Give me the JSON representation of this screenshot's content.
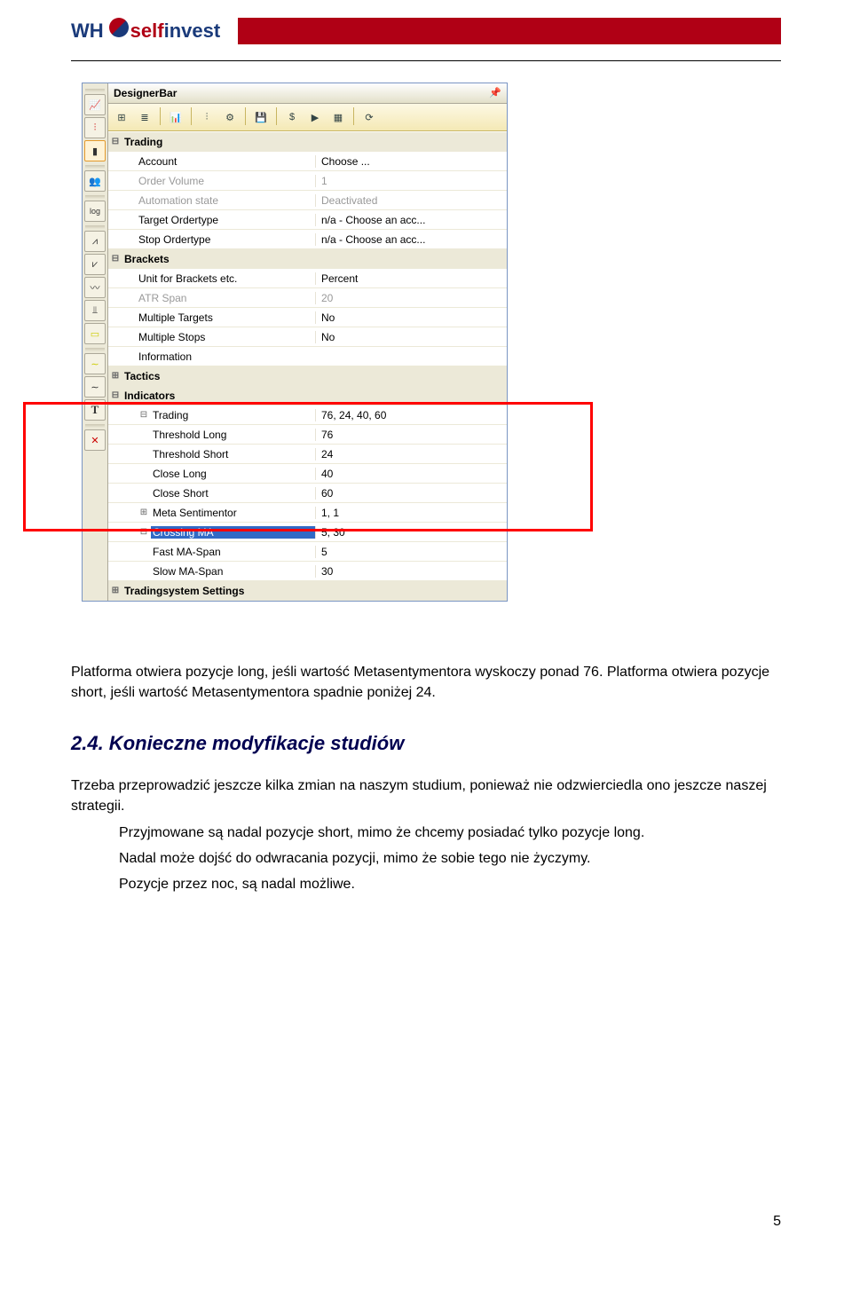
{
  "header": {
    "logo_wh": "WH",
    "logo_self": "self",
    "logo_invest": "invest"
  },
  "designer": {
    "title": "DesignerBar",
    "sections": {
      "trading": {
        "label": "Trading",
        "account_l": "Account",
        "account_v": "Choose ...",
        "ordervol_l": "Order Volume",
        "ordervol_v": "1",
        "auto_l": "Automation state",
        "auto_v": "Deactivated",
        "target_l": "Target Ordertype",
        "target_v": "n/a - Choose an acc...",
        "stop_l": "Stop Ordertype",
        "stop_v": "n/a - Choose an acc..."
      },
      "brackets": {
        "label": "Brackets",
        "unit_l": "Unit for Brackets etc.",
        "unit_v": "Percent",
        "atr_l": "ATR Span",
        "atr_v": "20",
        "mtgt_l": "Multiple Targets",
        "mtgt_v": "No",
        "mstp_l": "Multiple Stops",
        "mstp_v": "No",
        "info_l": "Information",
        "info_v": ""
      },
      "tactics": {
        "label": "Tactics"
      },
      "indicators": {
        "label": "Indicators",
        "trading_sub_l": "Trading",
        "trading_sub_v": "76, 24, 40, 60",
        "thl_l": "Threshold Long",
        "thl_v": "76",
        "ths_l": "Threshold Short",
        "ths_v": "24",
        "cll_l": "Close Long",
        "cll_v": "40",
        "cls_l": "Close Short",
        "cls_v": "60",
        "meta_l": "Meta Sentimentor",
        "meta_v": "1, 1",
        "cma_l": "Crossing MA",
        "cma_v": "5, 30",
        "fast_l": "Fast MA-Span",
        "fast_v": "5",
        "slow_l": "Slow MA-Span",
        "slow_v": "30"
      },
      "tss": {
        "label": "Tradingsystem Settings"
      }
    }
  },
  "text": {
    "p1": "Platforma otwiera pozycje long, jeśli wartość Metasentymentora wyskoczy ponad 76. Platforma otwiera pozycje short, jeśli wartość Metasentymentora spadnie poniżej 24.",
    "h2": "2.4. Konieczne modyfikacje studiów",
    "p2": "Trzeba przeprowadzić jeszcze kilka zmian na naszym studium, ponieważ nie odzwierciedla ono jeszcze naszej strategii.",
    "b1": "Przyjmowane są nadal pozycje short, mimo że chcemy posiadać tylko pozycje long.",
    "b2": "Nadal może dojść do odwracania pozycji, mimo że sobie tego nie życzymy.",
    "b3": "Pozycje przez noc, są nadal możliwe."
  },
  "page_number": "5"
}
